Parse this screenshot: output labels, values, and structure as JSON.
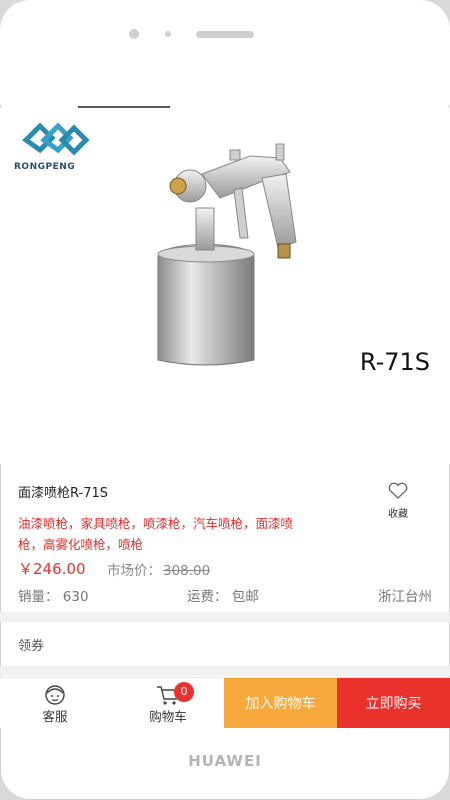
{
  "device": {
    "brand": "HUAWEI"
  },
  "hero": {
    "logo_text": "RONGPENG",
    "model": "R-71S"
  },
  "product": {
    "title": "面漆喷枪R-71S",
    "favorite_label": "收藏",
    "keywords_line1": "油漆喷枪，家具喷枪，喷漆枪，汽车喷枪，面漆喷",
    "keywords_line2": "枪，高雾化喷枪，喷枪",
    "price": "￥246.00",
    "market_label": "市场价：",
    "market_price": "308.00",
    "sales": "销量：  630",
    "shipping": "运费：  包邮",
    "location": "浙江台州",
    "coupon_label": "领券"
  },
  "bottom_bar": {
    "service_label": "客服",
    "cart_label": "购物车",
    "cart_count": "0",
    "add_to_cart": "加入购物车",
    "buy_now": "立即购买"
  },
  "colors": {
    "price_red": "#e6332a",
    "add_orange": "#f7a93c",
    "buy_red": "#e8322b",
    "logo_blue": "#2b8ab0"
  }
}
